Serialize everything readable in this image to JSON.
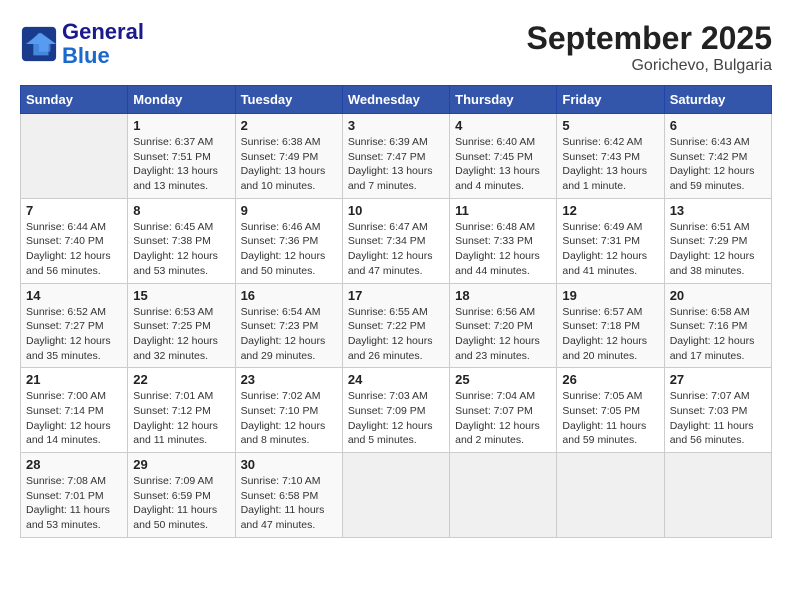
{
  "header": {
    "logo_general": "General",
    "logo_blue": "Blue",
    "title": "September 2025",
    "subtitle": "Gorichevo, Bulgaria"
  },
  "calendar": {
    "days_of_week": [
      "Sunday",
      "Monday",
      "Tuesday",
      "Wednesday",
      "Thursday",
      "Friday",
      "Saturday"
    ],
    "weeks": [
      [
        {
          "day": "",
          "empty": true
        },
        {
          "day": "1",
          "sunrise": "Sunrise: 6:37 AM",
          "sunset": "Sunset: 7:51 PM",
          "daylight": "Daylight: 13 hours and 13 minutes."
        },
        {
          "day": "2",
          "sunrise": "Sunrise: 6:38 AM",
          "sunset": "Sunset: 7:49 PM",
          "daylight": "Daylight: 13 hours and 10 minutes."
        },
        {
          "day": "3",
          "sunrise": "Sunrise: 6:39 AM",
          "sunset": "Sunset: 7:47 PM",
          "daylight": "Daylight: 13 hours and 7 minutes."
        },
        {
          "day": "4",
          "sunrise": "Sunrise: 6:40 AM",
          "sunset": "Sunset: 7:45 PM",
          "daylight": "Daylight: 13 hours and 4 minutes."
        },
        {
          "day": "5",
          "sunrise": "Sunrise: 6:42 AM",
          "sunset": "Sunset: 7:43 PM",
          "daylight": "Daylight: 13 hours and 1 minute."
        },
        {
          "day": "6",
          "sunrise": "Sunrise: 6:43 AM",
          "sunset": "Sunset: 7:42 PM",
          "daylight": "Daylight: 12 hours and 59 minutes."
        }
      ],
      [
        {
          "day": "7",
          "sunrise": "Sunrise: 6:44 AM",
          "sunset": "Sunset: 7:40 PM",
          "daylight": "Daylight: 12 hours and 56 minutes."
        },
        {
          "day": "8",
          "sunrise": "Sunrise: 6:45 AM",
          "sunset": "Sunset: 7:38 PM",
          "daylight": "Daylight: 12 hours and 53 minutes."
        },
        {
          "day": "9",
          "sunrise": "Sunrise: 6:46 AM",
          "sunset": "Sunset: 7:36 PM",
          "daylight": "Daylight: 12 hours and 50 minutes."
        },
        {
          "day": "10",
          "sunrise": "Sunrise: 6:47 AM",
          "sunset": "Sunset: 7:34 PM",
          "daylight": "Daylight: 12 hours and 47 minutes."
        },
        {
          "day": "11",
          "sunrise": "Sunrise: 6:48 AM",
          "sunset": "Sunset: 7:33 PM",
          "daylight": "Daylight: 12 hours and 44 minutes."
        },
        {
          "day": "12",
          "sunrise": "Sunrise: 6:49 AM",
          "sunset": "Sunset: 7:31 PM",
          "daylight": "Daylight: 12 hours and 41 minutes."
        },
        {
          "day": "13",
          "sunrise": "Sunrise: 6:51 AM",
          "sunset": "Sunset: 7:29 PM",
          "daylight": "Daylight: 12 hours and 38 minutes."
        }
      ],
      [
        {
          "day": "14",
          "sunrise": "Sunrise: 6:52 AM",
          "sunset": "Sunset: 7:27 PM",
          "daylight": "Daylight: 12 hours and 35 minutes."
        },
        {
          "day": "15",
          "sunrise": "Sunrise: 6:53 AM",
          "sunset": "Sunset: 7:25 PM",
          "daylight": "Daylight: 12 hours and 32 minutes."
        },
        {
          "day": "16",
          "sunrise": "Sunrise: 6:54 AM",
          "sunset": "Sunset: 7:23 PM",
          "daylight": "Daylight: 12 hours and 29 minutes."
        },
        {
          "day": "17",
          "sunrise": "Sunrise: 6:55 AM",
          "sunset": "Sunset: 7:22 PM",
          "daylight": "Daylight: 12 hours and 26 minutes."
        },
        {
          "day": "18",
          "sunrise": "Sunrise: 6:56 AM",
          "sunset": "Sunset: 7:20 PM",
          "daylight": "Daylight: 12 hours and 23 minutes."
        },
        {
          "day": "19",
          "sunrise": "Sunrise: 6:57 AM",
          "sunset": "Sunset: 7:18 PM",
          "daylight": "Daylight: 12 hours and 20 minutes."
        },
        {
          "day": "20",
          "sunrise": "Sunrise: 6:58 AM",
          "sunset": "Sunset: 7:16 PM",
          "daylight": "Daylight: 12 hours and 17 minutes."
        }
      ],
      [
        {
          "day": "21",
          "sunrise": "Sunrise: 7:00 AM",
          "sunset": "Sunset: 7:14 PM",
          "daylight": "Daylight: 12 hours and 14 minutes."
        },
        {
          "day": "22",
          "sunrise": "Sunrise: 7:01 AM",
          "sunset": "Sunset: 7:12 PM",
          "daylight": "Daylight: 12 hours and 11 minutes."
        },
        {
          "day": "23",
          "sunrise": "Sunrise: 7:02 AM",
          "sunset": "Sunset: 7:10 PM",
          "daylight": "Daylight: 12 hours and 8 minutes."
        },
        {
          "day": "24",
          "sunrise": "Sunrise: 7:03 AM",
          "sunset": "Sunset: 7:09 PM",
          "daylight": "Daylight: 12 hours and 5 minutes."
        },
        {
          "day": "25",
          "sunrise": "Sunrise: 7:04 AM",
          "sunset": "Sunset: 7:07 PM",
          "daylight": "Daylight: 12 hours and 2 minutes."
        },
        {
          "day": "26",
          "sunrise": "Sunrise: 7:05 AM",
          "sunset": "Sunset: 7:05 PM",
          "daylight": "Daylight: 11 hours and 59 minutes."
        },
        {
          "day": "27",
          "sunrise": "Sunrise: 7:07 AM",
          "sunset": "Sunset: 7:03 PM",
          "daylight": "Daylight: 11 hours and 56 minutes."
        }
      ],
      [
        {
          "day": "28",
          "sunrise": "Sunrise: 7:08 AM",
          "sunset": "Sunset: 7:01 PM",
          "daylight": "Daylight: 11 hours and 53 minutes."
        },
        {
          "day": "29",
          "sunrise": "Sunrise: 7:09 AM",
          "sunset": "Sunset: 6:59 PM",
          "daylight": "Daylight: 11 hours and 50 minutes."
        },
        {
          "day": "30",
          "sunrise": "Sunrise: 7:10 AM",
          "sunset": "Sunset: 6:58 PM",
          "daylight": "Daylight: 11 hours and 47 minutes."
        },
        {
          "day": "",
          "empty": true
        },
        {
          "day": "",
          "empty": true
        },
        {
          "day": "",
          "empty": true
        },
        {
          "day": "",
          "empty": true
        }
      ]
    ]
  }
}
